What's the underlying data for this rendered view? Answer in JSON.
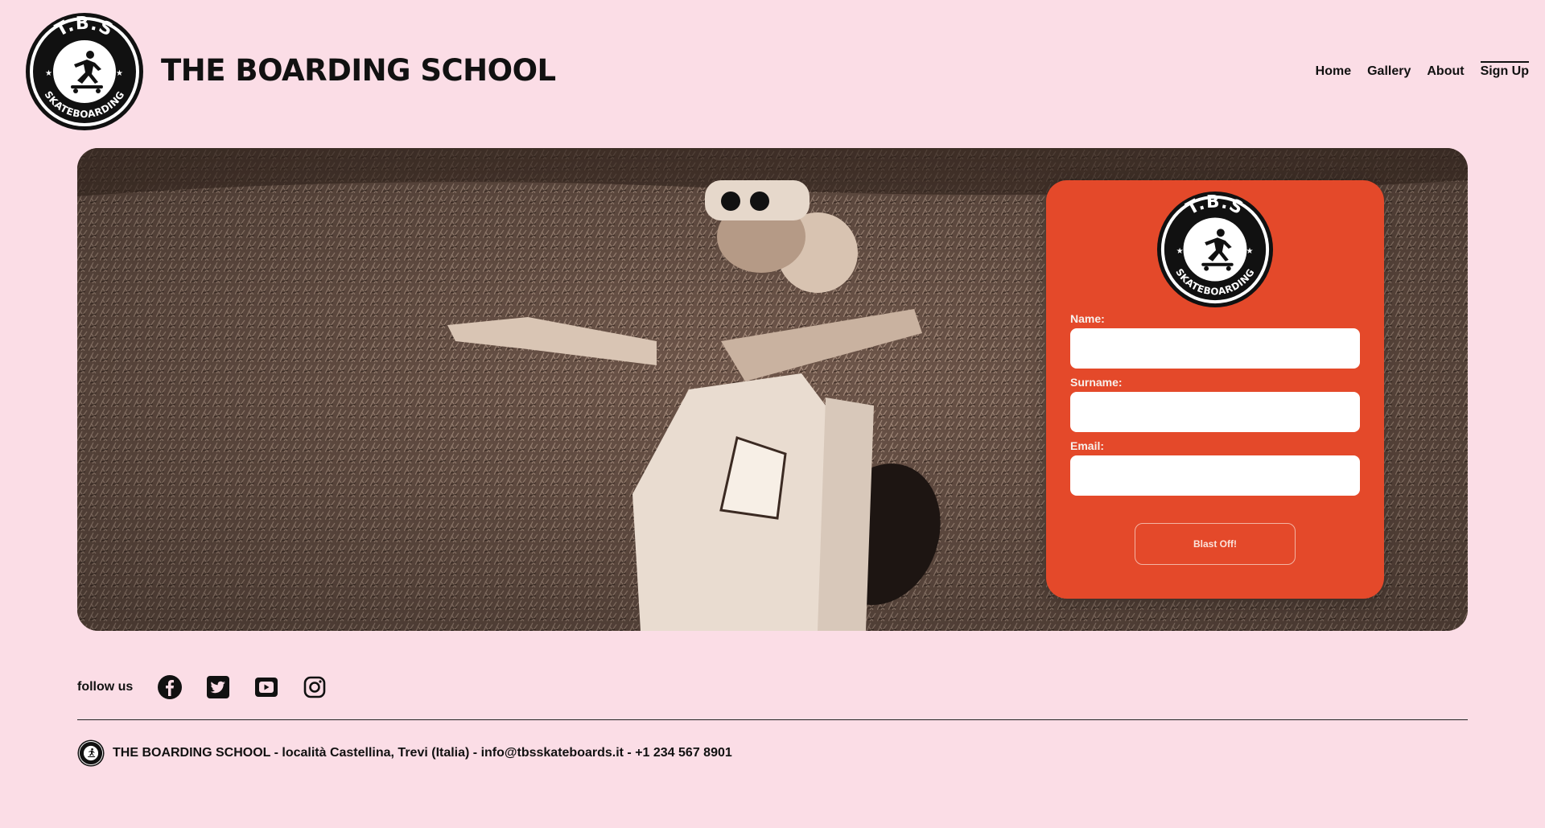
{
  "header": {
    "logo": {
      "top_text": "T.B.S",
      "bottom_text": "SKATEBOARDING"
    },
    "title": "THE BOARDING SCHOOL",
    "nav": [
      {
        "label": "Home"
      },
      {
        "label": "Gallery"
      },
      {
        "label": "About"
      },
      {
        "label": "Sign Up"
      }
    ]
  },
  "form": {
    "fields": [
      {
        "label": "Name:",
        "value": "",
        "placeholder": ""
      },
      {
        "label": "Surname:",
        "value": "",
        "placeholder": ""
      },
      {
        "label": "Email:",
        "value": "",
        "placeholder": ""
      }
    ],
    "submit_label": "Blast Off!"
  },
  "follow": {
    "label": "follow us",
    "icons": [
      "facebook-icon",
      "twitter-icon",
      "youtube-icon",
      "instagram-icon"
    ]
  },
  "footer": {
    "text": "THE BOARDING SCHOOL - località Castellina, Trevi (Italia) - info@tbsskateboards.it - +1 234 567 8901"
  },
  "colors": {
    "background": "#fbdde6",
    "form_card": "#e4492a",
    "text": "#111111"
  }
}
